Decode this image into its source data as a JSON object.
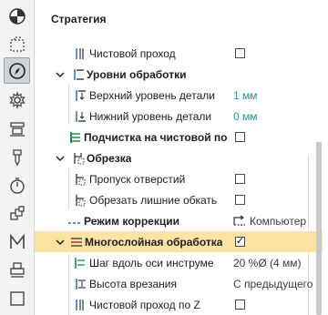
{
  "panel": {
    "title": "Стратегия"
  },
  "rows": [
    {
      "label": "Чистовой проход"
    },
    {
      "label": "Уровни обработки"
    },
    {
      "label": "Верхний уровень детали",
      "value": "1 мм"
    },
    {
      "label": "Нижний уровень детали",
      "value": "0 мм"
    },
    {
      "label": "Подчистка на чистовой по"
    },
    {
      "label": "Обрезка"
    },
    {
      "label": "Пропуск отверстий"
    },
    {
      "label": "Обрезать лишние обкать"
    },
    {
      "label": "Режим коррекции",
      "value": "Компьютер"
    },
    {
      "label": "Многослойная обработка",
      "checked_mark": "✓"
    },
    {
      "label": "Шаг вдоль оси инструме",
      "value": "20 %Ø (4 мм)"
    },
    {
      "label": "Высота врезания",
      "value": "С предыдущего"
    },
    {
      "label": "Чистовой проход по Z"
    }
  ],
  "toolbar": [
    {
      "icon": "pie-icon"
    },
    {
      "icon": "dashed-box-icon"
    },
    {
      "icon": "compass-icon",
      "selected": true
    },
    {
      "icon": "gear-icon"
    },
    {
      "icon": "machine-icon"
    },
    {
      "icon": "drill-icon"
    },
    {
      "icon": "clock-icon"
    },
    {
      "icon": "layers-icon"
    },
    {
      "icon": "m-letter-icon"
    },
    {
      "icon": "printer-icon"
    },
    {
      "icon": "square-icon"
    }
  ],
  "colors": {
    "accent": "#1a9c9c",
    "highlight": "#fde3a3",
    "selected": "#cfd3d9"
  }
}
